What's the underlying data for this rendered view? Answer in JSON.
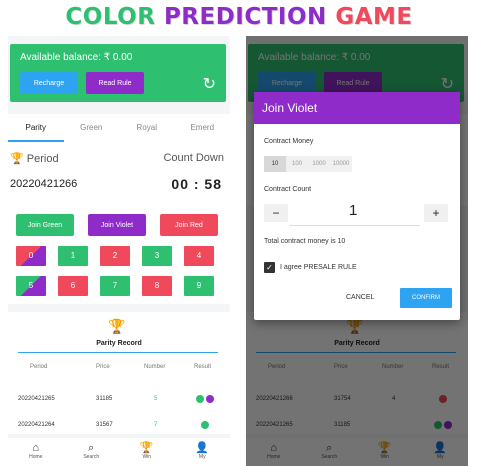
{
  "banner": {
    "word1": "COLOR",
    "word2": "PREDICTION",
    "word3": "GAME"
  },
  "screen": {
    "balance": "Available balance: ₹ 0.00",
    "recharge": "Recharge",
    "read_rule": "Read Rule",
    "refresh_glyph": "↻",
    "tabs": [
      "Parity",
      "Green",
      "Royal",
      "Emerd"
    ],
    "period_label": "Period",
    "countdown_label": "Count Down",
    "period_num": "20220421266",
    "timer": "00 : 58",
    "join_green": "Join Green",
    "join_violet": "Join Violet",
    "join_red": "Join Red",
    "numbers": [
      "0",
      "1",
      "2",
      "3",
      "4",
      "5",
      "6",
      "7",
      "8",
      "9"
    ],
    "record_title": "Parity Record",
    "table_headers": [
      "Period",
      "Price",
      "Number",
      "Result"
    ],
    "rows": [
      {
        "period": "20220421265",
        "price": "31185",
        "number": "5"
      },
      {
        "period": "20220421264",
        "price": "31567",
        "number": "7"
      }
    ],
    "nav": [
      "Home",
      "Search",
      "Win",
      "My"
    ]
  },
  "right_screen": {
    "rows": [
      {
        "period": "20220421266",
        "price": "31754",
        "number": "4"
      },
      {
        "period": "20220421265",
        "price": "31185",
        "number": ""
      }
    ]
  },
  "dialog": {
    "title": "Join Violet",
    "contract_money": "Contract Money",
    "amounts": [
      "10",
      "100",
      "1000",
      "10000"
    ],
    "contract_count": "Contract Count",
    "minus": "−",
    "count": "1",
    "plus": "+",
    "total": "Total contract money is 10",
    "agree": "I agree PRESALE RULE",
    "cancel": "CANCEL",
    "confirm": "CONFIRM"
  },
  "colors": {
    "green": "#2fbf71",
    "violet": "#8e2bc9",
    "red": "#f0495b",
    "blue": "#2ea3f2"
  }
}
